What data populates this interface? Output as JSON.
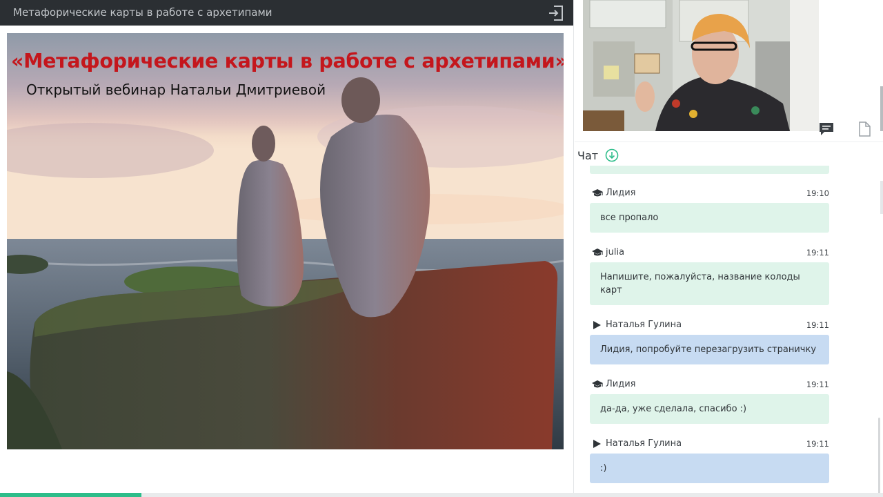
{
  "window": {
    "title": "Метафорические карты в работе с архетипами"
  },
  "slide": {
    "title": "«Метафорические карты в работе с архетипами»",
    "subtitle": "Открытый вебинар Натальи Дмитриевой"
  },
  "chat": {
    "header": "Чат",
    "messages": [
      {
        "author": "Лидия",
        "role_icon": "graduation-cap-icon",
        "time": "19:10",
        "text": "все пропало",
        "color": "green"
      },
      {
        "author": "julia",
        "role_icon": "graduation-cap-icon",
        "time": "19:11",
        "text": "Напишите, пожалуйста, название колоды карт",
        "color": "green"
      },
      {
        "author": "Наталья Гулина",
        "role_icon": "play-icon",
        "time": "19:11",
        "text": "Лидия, попробуйте перезагрузить страничку",
        "color": "blue"
      },
      {
        "author": "Лидия",
        "role_icon": "graduation-cap-icon",
        "time": "19:11",
        "text": "да-да, уже сделала, спасибо :)",
        "color": "blue-green"
      },
      {
        "author": "Наталья Гулина",
        "role_icon": "play-icon",
        "time": "19:11",
        "text": ":)",
        "color": "blue"
      }
    ]
  },
  "icons": {
    "exit": "exit-icon",
    "chat_toggle": "chat-bubble-icon",
    "doc_toggle": "document-icon",
    "scroll_down": "arrow-down-circle-icon"
  },
  "colors": {
    "topbar": "#2b2f33",
    "slide_title": "#c4161c",
    "accent": "#2dbd8a",
    "bubble_student": "#dff4ea",
    "bubble_host": "#c7dbf2"
  },
  "playback": {
    "progress_fraction": 0.16
  }
}
